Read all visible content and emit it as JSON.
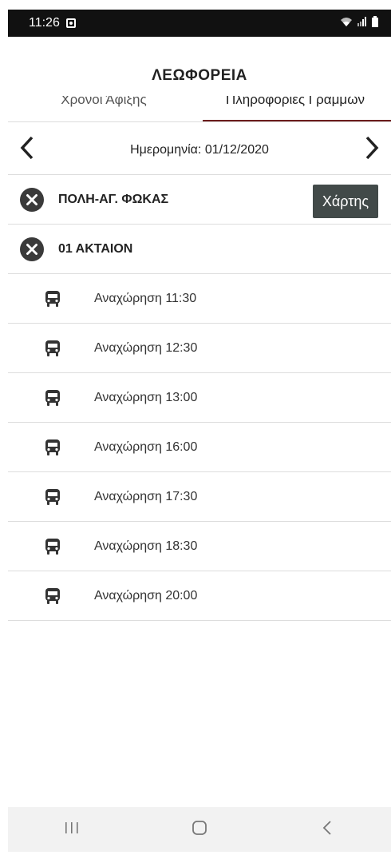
{
  "status": {
    "time": "11:26"
  },
  "header": {
    "title": "ΛΕΩΦΟΡΕΙΑ"
  },
  "tabs": [
    {
      "label": "Χρονοι Άφιξης",
      "active": false
    },
    {
      "label": "Πληροφοριες Γραμμων",
      "active": true
    }
  ],
  "datebar": {
    "label": "Ημερομηνία: 01/12/2020"
  },
  "routes": [
    {
      "name": "ΠΟΛΗ-ΑΓ. ΦΩΚΑΣ",
      "map_button": "Χάρτης"
    },
    {
      "name": "01 ΑΚΤΑΙΟΝ"
    }
  ],
  "departures": [
    "Αναχώρηση 11:30",
    "Αναχώρηση 12:30",
    "Αναχώρηση 13:00",
    "Αναχώρηση 16:00",
    "Αναχώρηση 17:30",
    "Αναχώρηση 18:30",
    "Αναχώρηση 20:00"
  ],
  "icons": {
    "close": "close-circle-icon",
    "bus": "bus-icon",
    "prev": "chevron-left-icon",
    "next": "chevron-right-icon"
  },
  "colors": {
    "tab_underline": "#6b1c1c",
    "map_button_bg": "#424a49",
    "close_icon": "#3a3a3a"
  }
}
